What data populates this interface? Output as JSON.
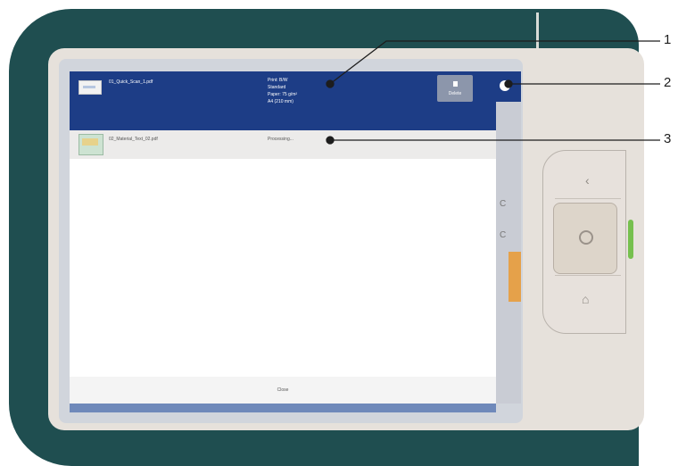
{
  "job_list": {
    "rows": [
      {
        "file_name": "01_Quick_Scan_1.pdf",
        "details": [
          "Print: B/W",
          "Standard",
          "Paper: 75 g/m²",
          "A4 (210 mm)"
        ],
        "selected": true
      },
      {
        "file_name": "02_Material_Text_02.pdf",
        "status": "Processing..."
      }
    ],
    "delete_label": "Delete",
    "close_label": "Close"
  },
  "callouts": [
    "1",
    "2",
    "3"
  ],
  "side_marks": [
    "C",
    "C"
  ],
  "colors": {
    "device_body": "#1f4e50",
    "selected_row": "#1d3d86",
    "screen_bottom": "#6f89ba",
    "indicator_green": "#76c04e",
    "indicator_orange": "#e5a14a"
  },
  "icons": {
    "delete": "trash-icon",
    "back": "back-icon",
    "center": "ok-icon",
    "home": "home-icon"
  }
}
